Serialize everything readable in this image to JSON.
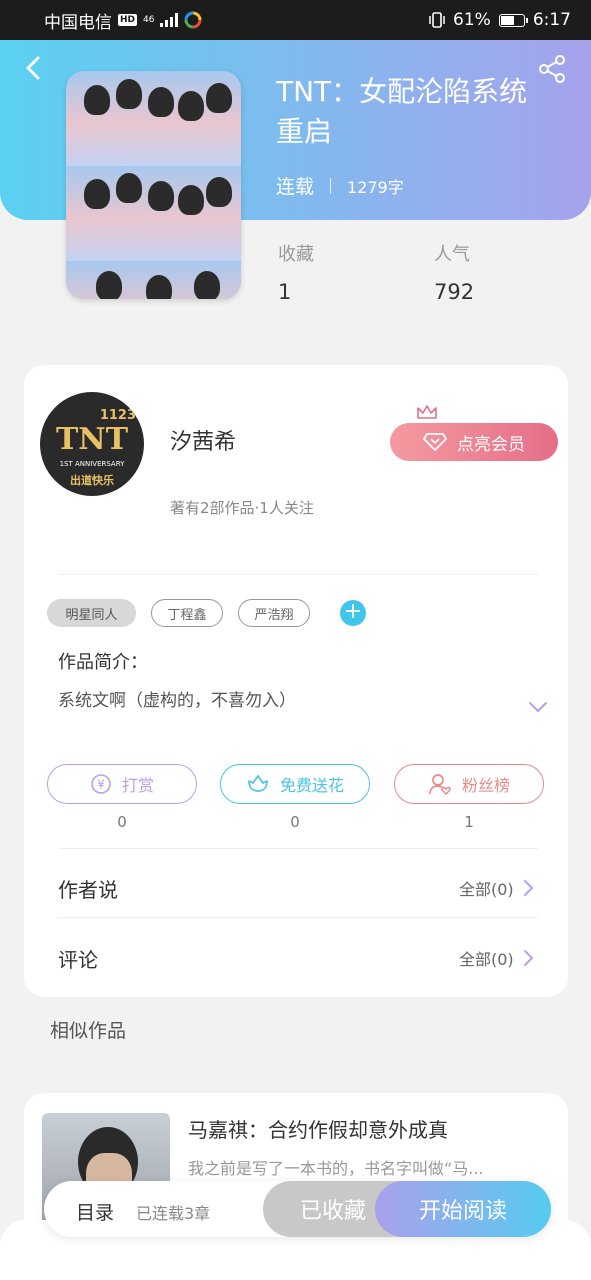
{
  "status_bar": {
    "carrier": "中国电信",
    "hd": "HD",
    "network": "46",
    "battery_pct": "61%",
    "battery_level": 0.61,
    "time": "6:17"
  },
  "header": {
    "back_icon": "chevron-left-icon",
    "share_icon": "share-icon",
    "colors": {
      "gradient_start": "#5ad1f0",
      "gradient_end": "#a6a3ec"
    }
  },
  "book": {
    "title": "TNT：女配沦陷系统重启",
    "status": "连载",
    "word_count": "1279字",
    "favorites_label": "收藏",
    "favorites_value": "1",
    "popularity_label": "人气",
    "popularity_value": "792"
  },
  "author": {
    "name": "汐茜希",
    "meta": "著有2部作品·1人关注",
    "vip_label": "点亮会员",
    "avatar_text": {
      "num": "1123",
      "logo": "TNT",
      "sub": "1ST ANNIVERSARY",
      "sub2": "出道快乐"
    }
  },
  "tags": [
    "明星同人",
    "丁程鑫",
    "严浩翔"
  ],
  "intro": {
    "label": "作品简介：",
    "text": "系统文啊（虚构的，不喜勿入）"
  },
  "actions": [
    {
      "label": "打赏",
      "count": "0",
      "icon": "yen-coin-icon",
      "color": "#b9a0e6"
    },
    {
      "label": "免费送花",
      "count": "0",
      "icon": "flower-icon",
      "color": "#48c3e8"
    },
    {
      "label": "粉丝榜",
      "count": "1",
      "icon": "user-heart-icon",
      "color": "#e98a88"
    }
  ],
  "rows": {
    "author_says": {
      "label": "作者说",
      "all": "全部(0)"
    },
    "comments": {
      "label": "评论",
      "all": "全部(0)"
    }
  },
  "similar": {
    "heading": "相似作品",
    "items": [
      {
        "title": "马嘉祺：合约作假却意外成真",
        "desc": "我之前是写了一本书的，书名字叫做“马..."
      }
    ]
  },
  "bottom": {
    "toc": "目录",
    "chapters": "已连载3章",
    "collected": "已收藏",
    "start_reading": "开始阅读"
  }
}
